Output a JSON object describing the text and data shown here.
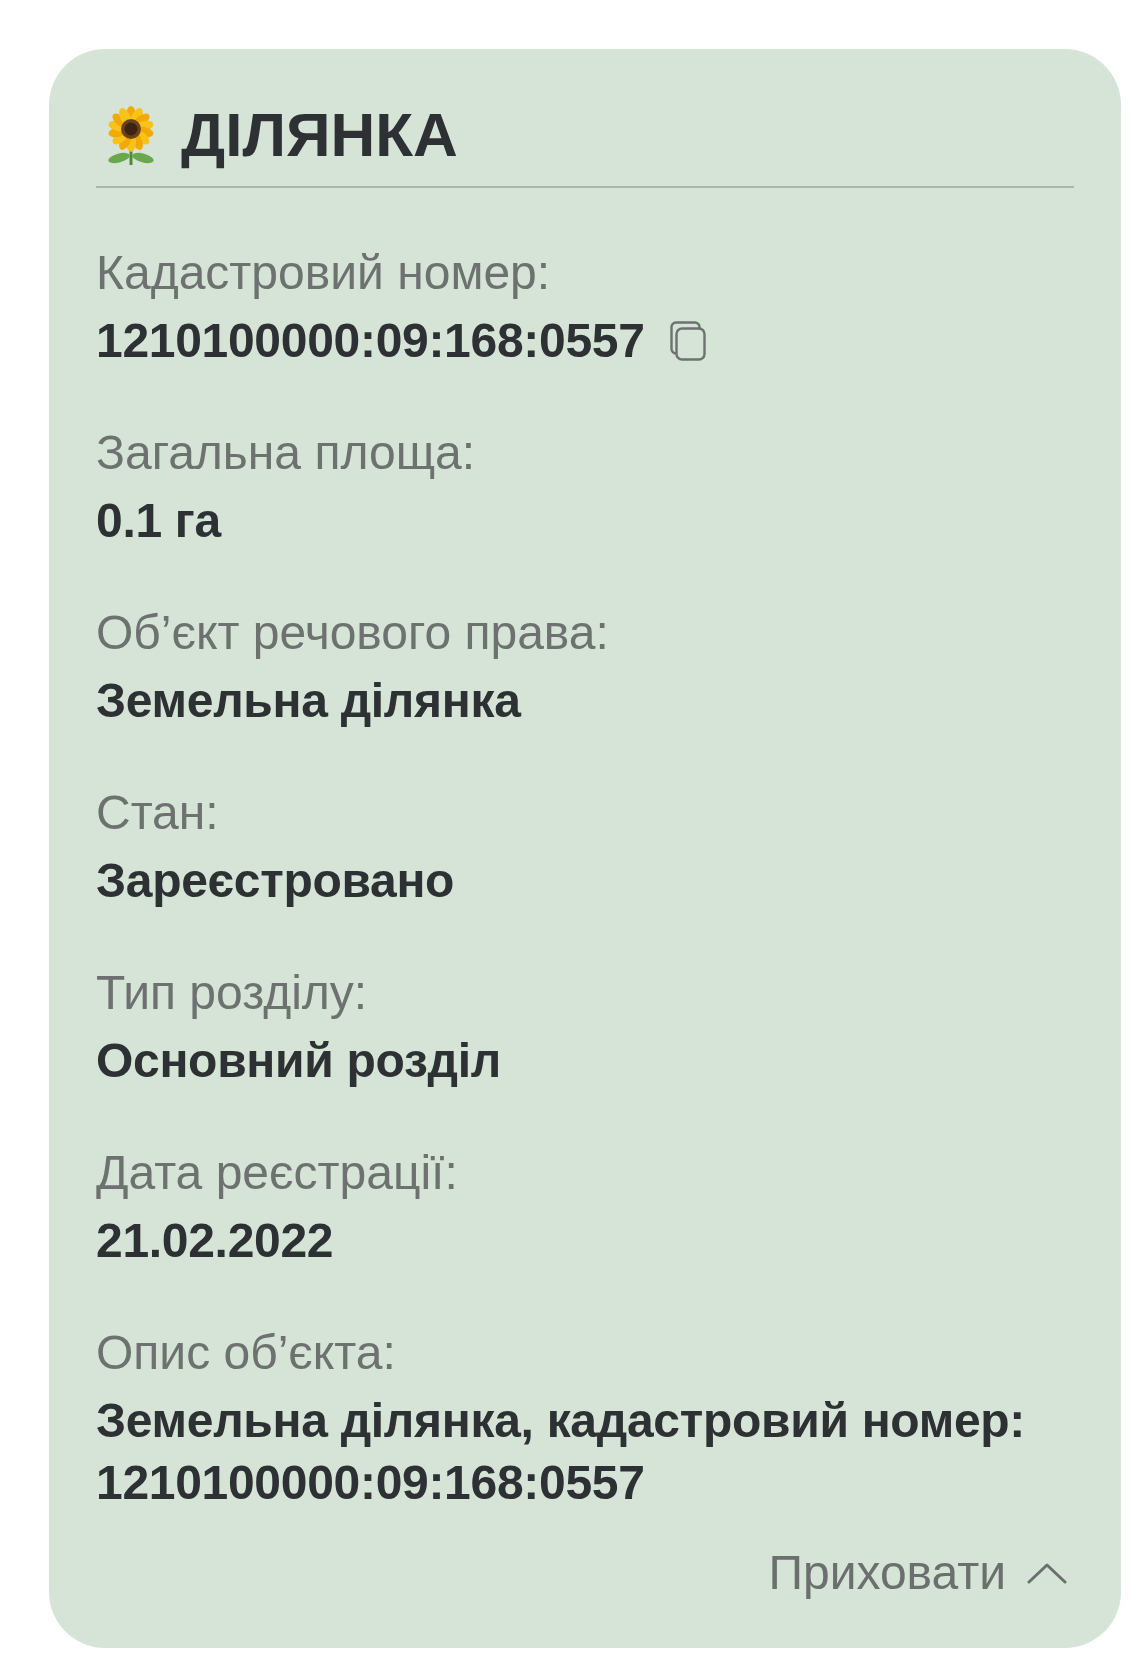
{
  "section": {
    "title": "ДІЛЯНКА",
    "expanded": true
  },
  "fields": [
    {
      "label": "Кадастровий номер:",
      "value": "1210100000:09:168:0557",
      "kind": "copyable"
    },
    {
      "label": "Загальна площа:",
      "value": "0.1 га",
      "kind": "text"
    },
    {
      "label": "Об’єкт речового права:",
      "value": "Земельна ділянка",
      "kind": "text"
    },
    {
      "label": "Стан:",
      "value": "Зареєстровано",
      "kind": "text"
    },
    {
      "label": "Тип розділу:",
      "value": "Основний розділ",
      "kind": "text"
    },
    {
      "label": "Дата реєстрації:",
      "value": "21.02.2022",
      "kind": "text"
    },
    {
      "label": "Опис об’єкта:",
      "value": "Земельна ділянка, кадастровий номер: 1210100000:09:168:0557",
      "kind": "text"
    }
  ],
  "collapse_button": {
    "label": "Приховати"
  }
}
